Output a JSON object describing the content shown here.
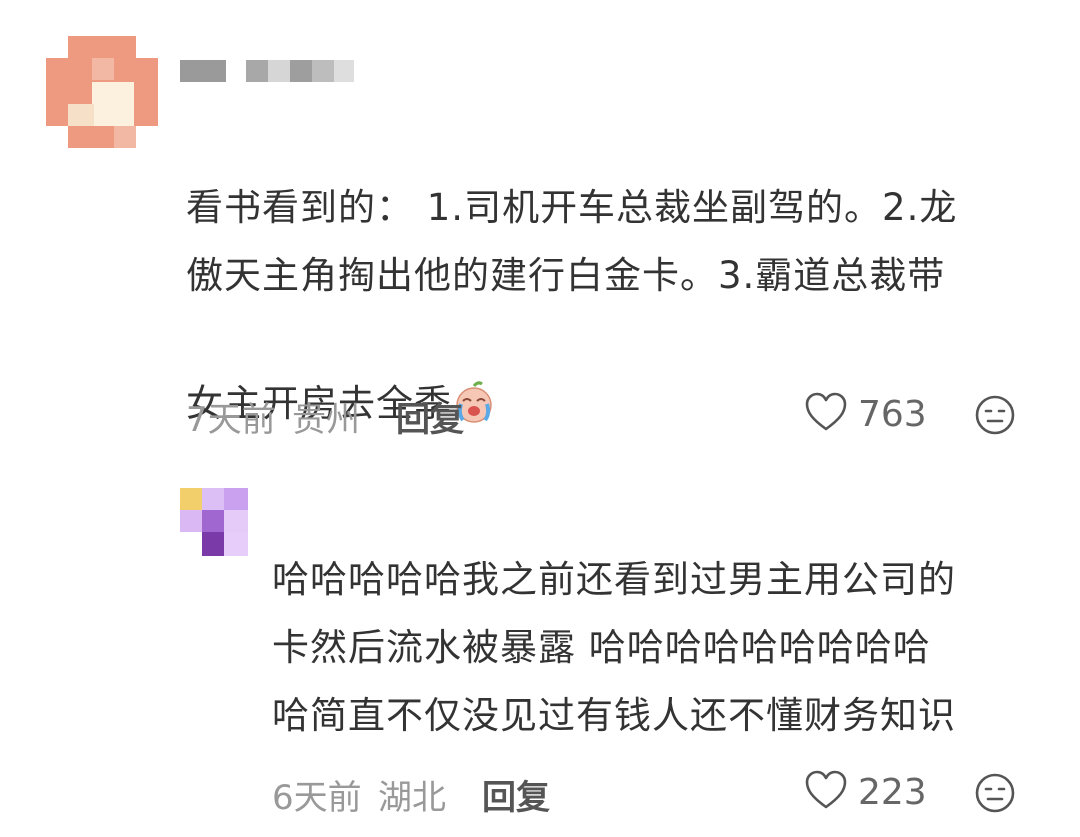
{
  "comment": {
    "text": "看书看到的： 1.司机开车总裁坐副驾的。2.龙\n傲天主角掏出他的建行白金卡。3.霸道总裁带\n女主开房去全季",
    "inline_emoji": "crying-laughing-baby-emoji",
    "time": "7天前",
    "location": "贵州",
    "reply_label": "回复",
    "likes": "763"
  },
  "reply": {
    "text": "哈哈哈哈哈我之前还看到过男主用公司的\n卡然后流水被暴露 哈哈哈哈哈哈哈哈哈\n哈简直不仅没见过有钱人还不懂财务知识",
    "time": "6天前",
    "location": "湖北",
    "reply_label": "回复",
    "likes": "223"
  },
  "colors": {
    "avatar1": "#ee9a80",
    "avatar2": "#c89be8",
    "text": "#333333",
    "meta": "#999999"
  }
}
